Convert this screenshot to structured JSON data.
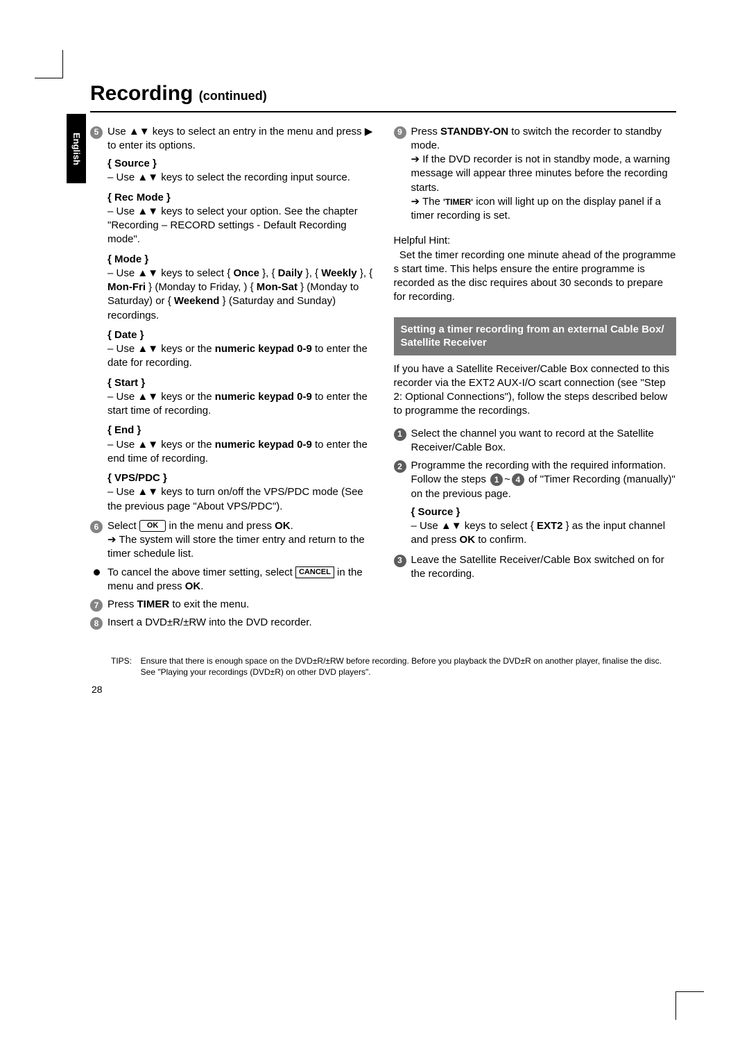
{
  "lang_tab": "English",
  "title_main": "Recording",
  "title_sub": "(continued)",
  "left": {
    "s5": "Use ▲▼ keys to select an entry in the menu and press ▶ to enter its options.",
    "source_h": "{ Source }",
    "source_b": "– Use ▲▼ keys to select the recording input source.",
    "rec_h": "{ Rec Mode }",
    "rec_b": "– Use ▲▼ keys to select your option. See the chapter \"Recording – RECORD settings - Default Recording mode\".",
    "mode_h": "{ Mode }",
    "mode_b1": "– Use ▲▼ keys to select { ",
    "once": "Once",
    " br1": " }, { ",
    "daily": "Daily",
    " br2": " }, { ",
    "weekly": "Weekly",
    " br3": " }, { ",
    "monfri": "Mon-Fri",
    " br4": " } (Monday to Friday, ) { ",
    "monsat": "Mon-Sat",
    " br5": " } (Monday to Saturday) or { ",
    "weekend": "Weekend",
    "mode_b2": " } (Saturday and Sunday) recordings.",
    "date_h": "{ Date }",
    "date_b1": "– Use ▲▼ keys or the ",
    "kp": "numeric keypad 0-9",
    "date_b2": " to enter the date for recording.",
    "start_h": "{ Start }",
    "start_b1": "– Use ▲▼ keys or the ",
    "start_b2": " to enter the start time of recording.",
    "end_h": "{ End }",
    "end_b1": "– Use ▲▼ keys or the ",
    "end_b2": " to enter the end time of recording.",
    "vps_h": "{ VPS/PDC }",
    "vps_b": "– Use ▲▼ keys to turn on/off the VPS/PDC mode (See the previous page \"About VPS/PDC\").",
    "s6a": "Select ",
    "ok_btn": "OK",
    "s6b": " in the menu and press ",
    "ok_word": "OK",
    "s6c": ".",
    "s6d": "➔ The system will store the timer entry and return to the timer schedule list.",
    "cancel1": "To cancel the above timer setting, select ",
    "cancel_btn": "CANCEL",
    "cancel2": " in the menu and press ",
    "cancel_ok": "OK",
    "cancel3": ".",
    "s7a": "Press ",
    "timer": "TIMER",
    "s7b": " to exit the menu.",
    "s8": "Insert a DVD±R/±RW into the DVD recorder."
  },
  "right": {
    "s9a": "Press ",
    "standby": "STANDBY-ON",
    "s9b": " to switch the recorder to standby mode.",
    "s9c": "➔ If the DVD recorder is not in standby mode, a warning message will appear three minutes before the recording starts.",
    "s9d1": "➔ The ",
    "timer_sc": "'TIMER'",
    "s9d2": " icon will light up on the display panel if a timer recording is set.",
    "hint_h": "Helpful Hint:",
    "hint_b": "  Set the timer recording one minute ahead of the programme s start time. This helps ensure the entire programme is recorded as the disc requires about 30 seconds to prepare for recording.",
    "box": "Setting a timer recording from an external Cable Box/ Satellite Receiver",
    "intro": "If you have a Satellite Receiver/Cable Box connected to this recorder via the EXT2 AUX-I/O scart connection (see \"Step 2: Optional Connections\"), follow the steps described below to programme the recordings.",
    "r1": "Select the channel you want to record at the Satellite Receiver/Cable Box.",
    "r2a": "Programme the recording with the required information. Follow the steps ",
    "r2b": "~",
    "r2c": " of \"Timer Recording (manually)\" on the previous page.",
    "src_h": "{ Source }",
    "src_b1": "– Use ▲▼ keys to select { ",
    "ext2": "EXT2",
    "src_b2": " } as the input channel and press ",
    "src_ok": "OK",
    "src_b3": " to confirm.",
    "r3": "Leave the Satellite Receiver/Cable Box switched on for the recording."
  },
  "tips_lbl": "TIPS:",
  "tips_body": "Ensure that there is enough space on the DVD±R/±RW before recording. Before you playback the DVD±R on another player, finalise the disc. See \"Playing your recordings (DVD±R) on other DVD players\".",
  "page_num": "28"
}
